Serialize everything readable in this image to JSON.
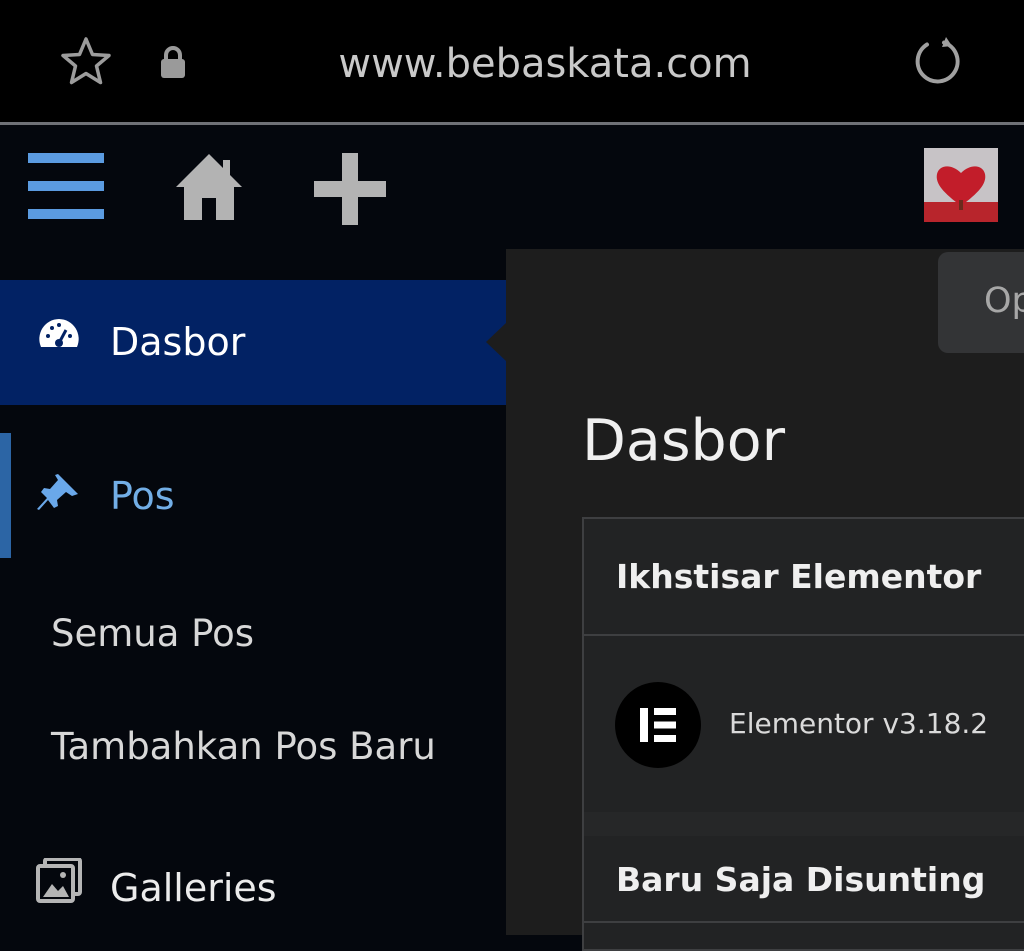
{
  "browser": {
    "url": "www.bebaskata.com",
    "icons": {
      "bookmark": "star-outline-icon",
      "secure": "lock-icon",
      "reload": "reload-icon"
    }
  },
  "admin_bar": {
    "icons": {
      "menu": "hamburger-menu-icon",
      "home": "home-icon",
      "new": "plus-icon"
    },
    "avatar_alt": "heart-avatar"
  },
  "sidebar": {
    "items": [
      {
        "label": "Dasbor",
        "icon": "dashboard-gauge-icon",
        "active": true
      },
      {
        "label": "Pos",
        "icon": "pushpin-icon",
        "current": true,
        "submenu": [
          "Semua Pos",
          "Tambahkan Pos Baru"
        ]
      },
      {
        "label": "Galleries",
        "icon": "gallery-images-icon"
      }
    ]
  },
  "main": {
    "screen_options_label": "Op",
    "page_title": "Dasbor",
    "widget": {
      "title": "Ikhstisar Elementor",
      "version": "Elementor v3.18.2",
      "section_title": "Baru Saja Disunting"
    }
  },
  "colors": {
    "active_menu_bg": "#022264",
    "pos_accent": "#72aee6",
    "admin_bar_menu_icon": "#72aee6",
    "content_bg": "#1d1d1d"
  }
}
